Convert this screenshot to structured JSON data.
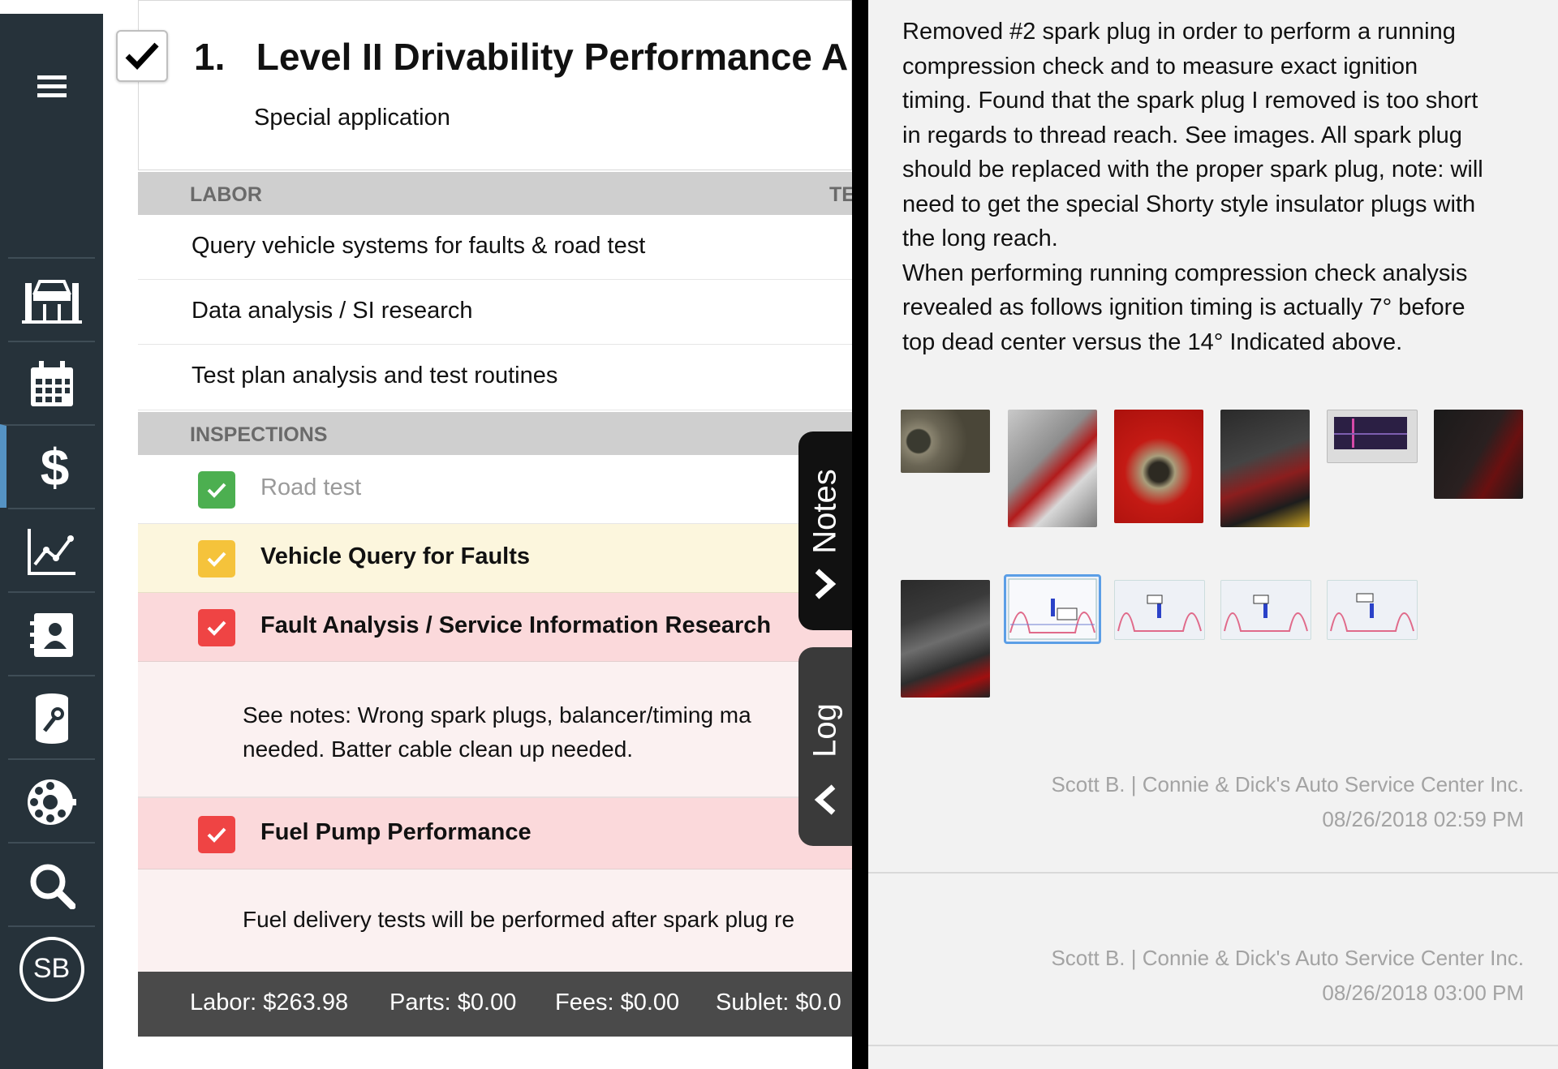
{
  "sidebar": {
    "menu_icon": "hamburger-icon",
    "items": [
      {
        "name": "lift-icon"
      },
      {
        "name": "calendar-icon"
      },
      {
        "name": "dollar-icon"
      },
      {
        "name": "chart-icon"
      },
      {
        "name": "contacts-icon"
      },
      {
        "name": "parts-icon"
      },
      {
        "name": "settings-icon"
      },
      {
        "name": "search-icon"
      }
    ],
    "avatar_initials": "SB",
    "accent_color": "#5593c4"
  },
  "job": {
    "number": "1.",
    "title": "Level II Drivability Performance A",
    "subtitle": "Special application",
    "labor_header": "LABOR",
    "labor_header_right": "TE",
    "labor_items": [
      "Query vehicle systems for faults & road test",
      "Data analysis / SI research",
      "Test plan analysis and test routines"
    ],
    "inspections_header": "INSPECTIONS",
    "inspections": [
      {
        "label": "Road test",
        "status": "green",
        "color": "#4caf50"
      },
      {
        "label": "Vehicle Query for Faults",
        "status": "yellow",
        "color": "#f5c33b"
      },
      {
        "label": "Fault Analysis / Service Information Research",
        "status": "red",
        "color": "#ef4444"
      },
      {
        "label": "Fuel Pump Performance",
        "status": "red",
        "color": "#ef4444"
      }
    ],
    "fault_note_line1": "See notes: Wrong spark plugs, balancer/timing ma",
    "fault_note_line2": "needed. Batter cable clean up needed.",
    "fuel_note": "Fuel delivery tests will be performed after spark plug re"
  },
  "totals": {
    "labor": "Labor: $263.98",
    "parts": "Parts: $0.00",
    "fees": "Fees: $0.00",
    "sublet": "Sublet: $0.0"
  },
  "tabs": {
    "notes": "Notes",
    "log": "Log"
  },
  "notes_panel": {
    "text_lines": [
      "Removed #2 spark plug in order to perform a running",
      "compression check and to measure exact ignition",
      "timing. Found that the spark plug I removed is too short",
      "in regards to thread reach. See images. All spark plug",
      "should be replaced with the proper spark plug, note: will",
      "need to get the special Shorty style insulator plugs with",
      "the long reach.",
      "When performing running compression check analysis",
      "revealed as follows ignition timing is actually 7° before",
      "top dead center versus the 14° Indicated above."
    ],
    "entries": [
      {
        "author": "Scott B. | Connie & Dick's Auto Service Center Inc.",
        "date": "08/26/2018 02:59 PM"
      },
      {
        "author": "Scott B. | Connie & Dick's Auto Service Center Inc.",
        "date": "08/26/2018 03:00 PM"
      }
    ]
  }
}
